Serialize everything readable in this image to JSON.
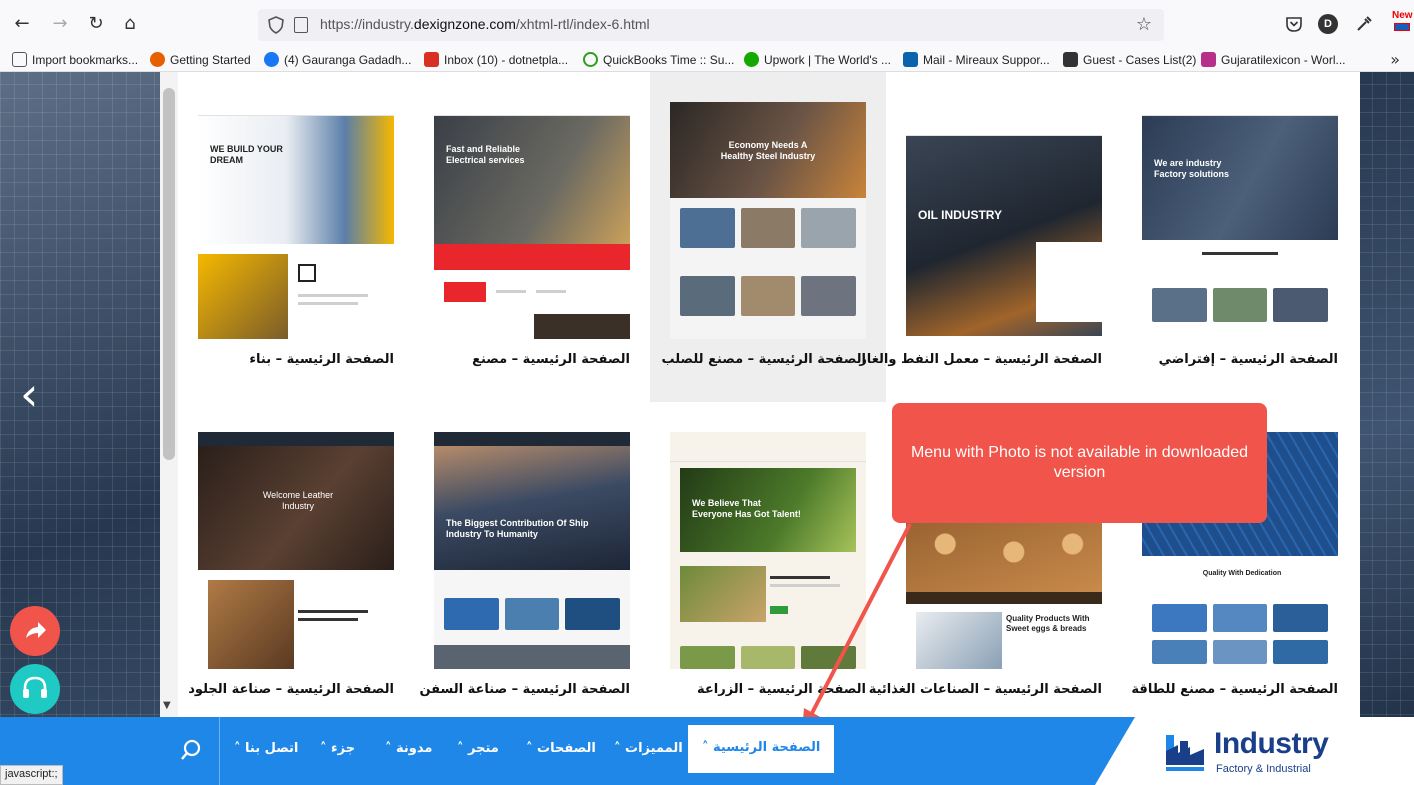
{
  "browser": {
    "url_prefix": "https://industry.",
    "url_domain": "dexignzone.com",
    "url_path": "/xhtml-rtl/index-6.html",
    "profile_initial": "D",
    "new_badge": "New"
  },
  "bookmarks": [
    {
      "label": "Import bookmarks...",
      "icon": "import-icon",
      "color": "#555555"
    },
    {
      "label": "Getting Started",
      "icon": "firefox-icon",
      "color": "#e66000"
    },
    {
      "label": "(4) Gauranga Gadadh...",
      "icon": "facebook-icon",
      "color": "#1877f2"
    },
    {
      "label": "Inbox (10) - dotnetpla...",
      "icon": "gmail-icon",
      "color": "#d93025"
    },
    {
      "label": "QuickBooks Time :: Su...",
      "icon": "quickbooks-icon",
      "color": "#2ca01c"
    },
    {
      "label": "Upwork | The World's ...",
      "icon": "upwork-icon",
      "color": "#14a800"
    },
    {
      "label": "Mail - Mireaux Suppor...",
      "icon": "outlook-icon",
      "color": "#0a64ad"
    },
    {
      "label": "Guest - Cases List(2)",
      "icon": "m-icon",
      "color": "#333333"
    },
    {
      "label": "Gujaratilexicon - Worl...",
      "icon": "gujarati-icon",
      "color": "#b6308a"
    }
  ],
  "cards_row1": [
    {
      "caption": "الصفحة الرئيسية – بناء",
      "hero_text": "WE BUILD YOUR DREAM",
      "hero": "#d8dde3",
      "accent": "#f5b800"
    },
    {
      "caption": "الصفحة الرئيسية – مصنع",
      "hero_text": "Fast and Reliable Electrical services",
      "hero": "#3a3f47",
      "accent": "#e8262b"
    },
    {
      "caption": "الصفحة الرئيسية – مصنع للصلب",
      "hero_text": "Economy Needs A Healthy Steel Industry",
      "hero": "#4a4744",
      "accent": "#2d6aa6"
    },
    {
      "caption": "الصفحة الرئيسية – معمل النفط والغاز",
      "hero_text": "OIL INDUSTRY",
      "hero": "#2c3340",
      "accent": "#e8262b"
    },
    {
      "caption": "الصفحة الرئيسية – إفتراضي",
      "hero_text": "We are industry Factory solutions",
      "hero": "#2c3c55",
      "accent": "#e8262b"
    }
  ],
  "cards_row2": [
    {
      "caption": "الصفحة الرئيسية – صناعة الجلود",
      "hero_text": "Welcome Leather Industry",
      "hero": "#3b2a22",
      "accent": "#f5931e"
    },
    {
      "caption": "الصفحة الرئيسية – صناعة السفن",
      "hero_text": "The Biggest Contribution Of Ship Industry To Humanity",
      "hero": "#3b4a63",
      "accent": "#1e9be8"
    },
    {
      "caption": "الصفحة الرئيسية – الزراعة",
      "hero_text": "We Believe That Everyone Has Got Talent!",
      "hero": "#3c5a2a",
      "accent": "#2e9c3a"
    },
    {
      "caption": "الصفحة الرئيسية – الصناعات الغذائية",
      "hero_text": "Quality Products With Sweet eggs & breads",
      "hero": "#c98a4a",
      "accent": "#f59c1a"
    },
    {
      "caption": "الصفحة الرئيسية – مصنع للطاقة",
      "hero_text": "Quality With Dedication",
      "hero": "#1e4f8c",
      "accent": "#1e78d8"
    }
  ],
  "callout": {
    "text": "Menu with Photo is not available in downloaded version"
  },
  "menu": {
    "items": [
      {
        "label": "الصفحة الرئيسية ˄",
        "active": true
      },
      {
        "label": "المميزات ˄"
      },
      {
        "label": "الصفحات ˄"
      },
      {
        "label": "متجر ˄"
      },
      {
        "label": "مدونة ˄"
      },
      {
        "label": "جزء ˄"
      },
      {
        "label": "اتصل بنا ˄"
      }
    ]
  },
  "logo": {
    "title": "Industry",
    "subtitle": "Factory & Industrial"
  },
  "status_text": "javascript:;",
  "colors": {
    "menu": "#1f87e8",
    "callout": "#f0544a",
    "share_fab": "#f0544a",
    "support_fab": "#1fc9c4"
  }
}
